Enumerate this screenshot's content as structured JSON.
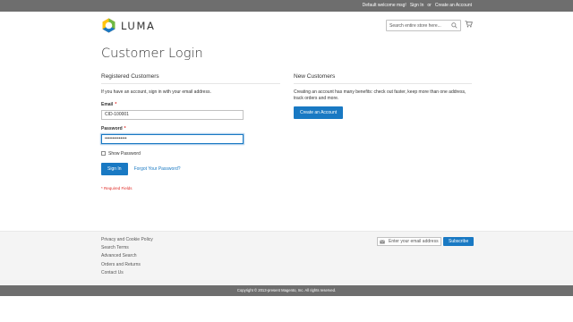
{
  "topbar": {
    "welcome": "Default welcome msg!",
    "sign_in": "Sign In",
    "or": "or",
    "create_account": "Create an Account"
  },
  "header": {
    "logo_text": "LUMA",
    "search_placeholder": "Search entire store here...",
    "search_icon": "search-icon",
    "cart_icon": "cart-icon"
  },
  "page": {
    "title": "Customer Login"
  },
  "registered": {
    "title": "Registered Customers",
    "intro": "If you have an account, sign in with your email address.",
    "email_label": "Email",
    "email_value": "CID-100001",
    "password_label": "Password",
    "password_value": "••••••••••••••",
    "required_marker": "*",
    "show_password": "Show Password",
    "sign_in_button": "Sign In",
    "forgot_link": "Forgot Your Password?",
    "required_fields": "* Required Fields"
  },
  "new_customers": {
    "title": "New Customers",
    "intro": "Creating an account has many benefits: check out faster, keep more than one address, track orders and more.",
    "create_button": "Create an Account"
  },
  "footer": {
    "links": [
      "Privacy and Cookie Policy",
      "Search Terms",
      "Advanced Search",
      "Orders and Returns",
      "Contact Us"
    ],
    "newsletter_placeholder": "Enter your email address",
    "subscribe_button": "Subscribe",
    "copyright": "Copyright © 2013-present Magento, Inc. All rights reserved."
  },
  "colors": {
    "accent": "#1979c3",
    "topbar": "#6e6e6e",
    "required": "#e02b27",
    "logo_orange": "#f26322",
    "logo_green": "#70b942",
    "logo_blue": "#1979c3"
  }
}
